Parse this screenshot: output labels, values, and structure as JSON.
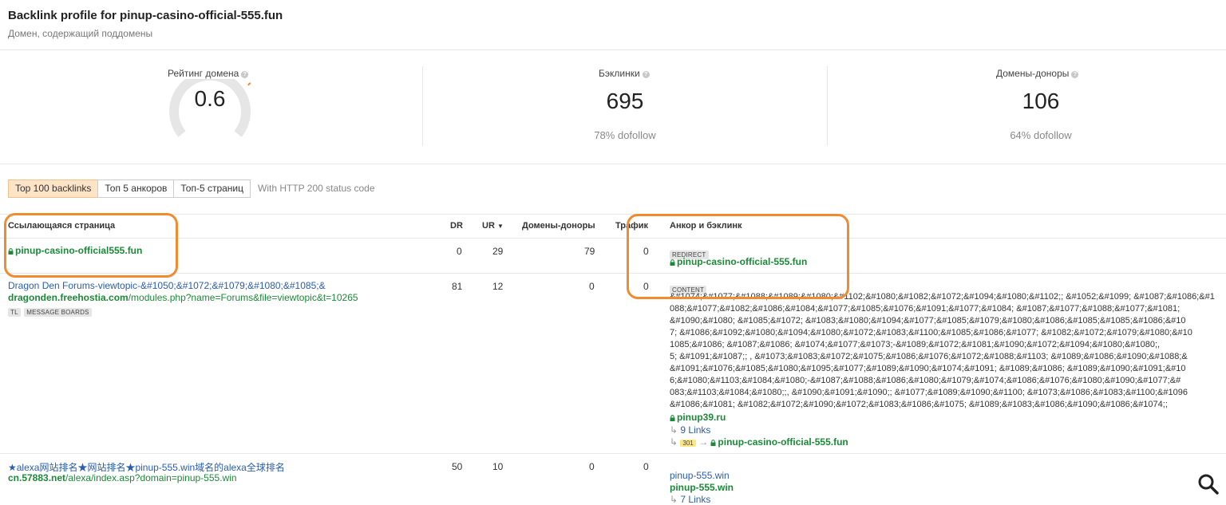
{
  "header": {
    "title": "Backlink profile for pinup-casino-official-555.fun",
    "subtitle": "Домен, содержащий поддомены"
  },
  "metrics": {
    "domain_rating": {
      "label": "Рейтинг домена",
      "value": "0.6",
      "fill": 0.006
    },
    "backlinks": {
      "label": "Бэклинки",
      "value": "695",
      "sub": "78% dofollow"
    },
    "ref_domains": {
      "label": "Домены-доноры",
      "value": "106",
      "sub": "64% dofollow"
    }
  },
  "tabs": {
    "items": [
      "Top 100 backlinks",
      "Топ 5 анкоров",
      "Топ-5 страниц"
    ],
    "note": "With HTTP 200 status code"
  },
  "table": {
    "headers": {
      "page": "Ссылающаяся страница",
      "dr": "DR",
      "ur": "UR",
      "domains": "Домены-доноры",
      "traffic": "Трафик",
      "anchor": "Анкор и бэклинк"
    },
    "rows": [
      {
        "page_domain": "pinup-casino-official555.fun",
        "dr": "0",
        "ur": "29",
        "domains": "79",
        "traffic": "0",
        "anchor_tag": "REDIRECT",
        "anchor_link": "pinup-casino-official-555.fun"
      },
      {
        "page_title": "Dragon Den Forums-viewtopic-&#1050;&#1072;&#1079;&#1080;&#1085;&",
        "page_domain": "dragonden.freehostia.com",
        "page_path": "/modules.php?name=Forums&file=viewtopic&t=10265",
        "tags": [
          "TL",
          "MESSAGE BOARDS"
        ],
        "dr": "81",
        "ur": "12",
        "domains": "0",
        "traffic": "0",
        "anchor_tag": "CONTENT",
        "anchor_lines": [
          "&#1074;&#1077;&#1088;&#1089;&#1080;&#1102;&#1080;&#1082;&#1072;&#1094;&#1080;&#1102;;  &#1052;&#1099;  &#1087;&#1086;&#1",
          "088;&#1077;&#1082;&#1086;&#1084;&#1077;&#1085;&#1076;&#1091;&#1077;&#1084;  &#1087;&#1077;&#1088;&#1077;&#1081;",
          "&#1090;&#1080;  &#1085;&#1072;  &#1083;&#1080;&#1094;&#1077;&#1085;&#1079;&#1080;&#1086;&#1085;&#1085;&#1086;&#10",
          "7;  &#1086;&#1092;&#1080;&#1094;&#1080;&#1072;&#1083;&#1100;&#1085;&#1086;&#1077;  &#1082;&#1072;&#1079;&#1080;&#10",
          "1085;&#1086;  &#1087;&#1086;  &#1074;&#1077;&#1073;-&#1089;&#1072;&#1081;&#1090;&#1072;&#1094;&#1080;&#1080;,",
          "5;  &#1091;&#1087;;  ,  &#1073;&#1083;&#1072;&#1075;&#1086;&#1076;&#1072;&#1088;&#1103;  &#1089;&#1086;&#1090;&#1088;&",
          "&#1091;&#1076;&#1085;&#1080;&#1095;&#1077;&#1089;&#1090;&#1074;&#1091;  &#1089;&#1086;  &#1089;&#1090;&#1091;&#10",
          "6;&#1080;&#1103;&#1084;&#1080;-&#1087;&#1088;&#1086;&#1080;&#1079;&#1074;&#1086;&#1076;&#1080;&#1090;&#1077;&#",
          "083;&#1103;&#1084;&#1080;;,  &#1090;&#1091;&#1090;;  &#1077;&#1089;&#1090;&#1100;  &#1073;&#1086;&#1083;&#1100;&#1096",
          "&#1086;&#1081;  &#1082;&#1072;&#1090;&#1072;&#1083;&#1086;&#1075;  &#1089;&#1083;&#1086;&#1090;&#1086;&#1074;;"
        ],
        "anchor_domain": "pinup39.ru",
        "anchor_links_count": "9 Links",
        "redirect_badge": "301",
        "redirect_target": "pinup-casino-official-555.fun"
      },
      {
        "page_title": "★alexa网站排名★网站排名★pinup-555.win域名的alexa全球排名",
        "page_domain": "cn.57883.net",
        "page_path": "/alexa/index.asp?domain=pinup-555.win",
        "dr": "50",
        "ur": "10",
        "domains": "0",
        "traffic": "0",
        "anchor_text": "pinup-555.win",
        "anchor_domain": "pinup-555.win",
        "anchor_links_count": "7 Links"
      }
    ]
  },
  "colors": {
    "accent_orange": "#f28a30",
    "link_green": "#1a8a37",
    "link_blue": "#2a5db0"
  }
}
